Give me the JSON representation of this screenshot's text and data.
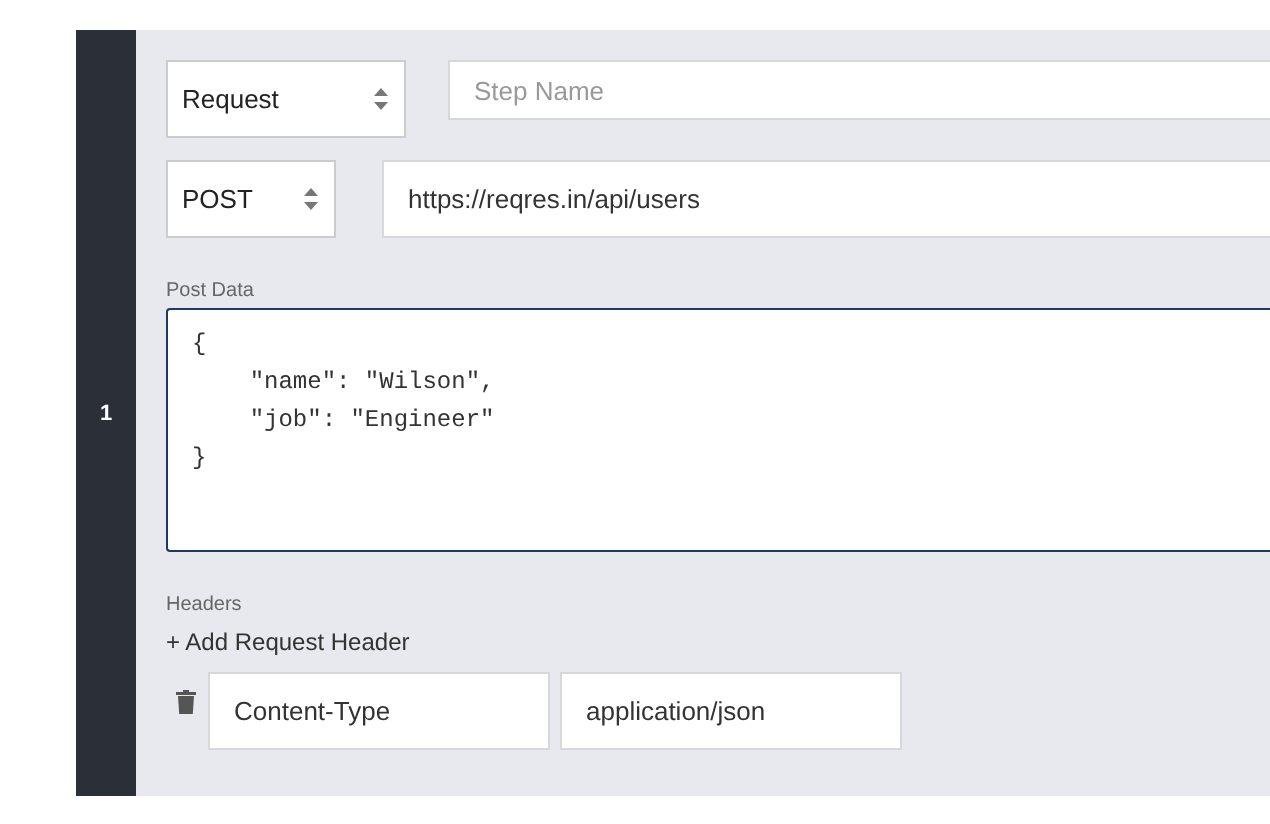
{
  "step": {
    "number": "1",
    "type_select": {
      "value": "Request"
    },
    "step_name": {
      "placeholder": "Step Name"
    },
    "method_select": {
      "value": "POST"
    },
    "url": {
      "value": "https://reqres.in/api/users"
    },
    "post_data": {
      "label": "Post Data",
      "value": "{\n    \"name\": \"Wilson\",\n    \"job\": \"Engineer\"\n}"
    },
    "headers": {
      "label": "Headers",
      "add_link": "+ Add Request Header",
      "rows": [
        {
          "name": "Content-Type",
          "value": "application/json"
        }
      ]
    }
  }
}
